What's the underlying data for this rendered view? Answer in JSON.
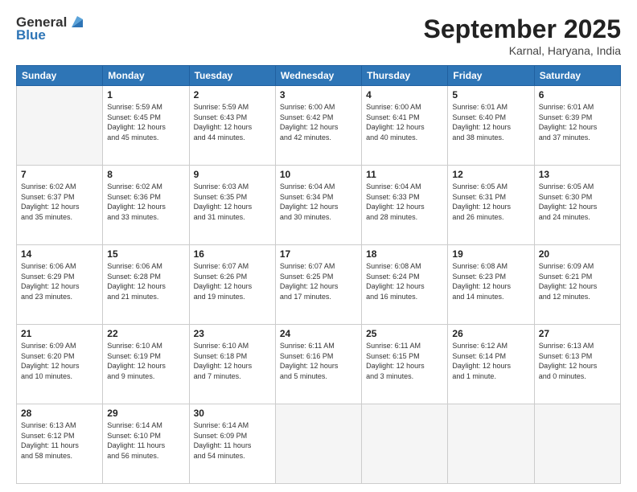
{
  "header": {
    "logo_general": "General",
    "logo_blue": "Blue",
    "title": "September 2025",
    "subtitle": "Karnal, Haryana, India"
  },
  "calendar": {
    "days_of_week": [
      "Sunday",
      "Monday",
      "Tuesday",
      "Wednesday",
      "Thursday",
      "Friday",
      "Saturday"
    ],
    "weeks": [
      [
        {
          "day": "",
          "info": ""
        },
        {
          "day": "1",
          "info": "Sunrise: 5:59 AM\nSunset: 6:45 PM\nDaylight: 12 hours\nand 45 minutes."
        },
        {
          "day": "2",
          "info": "Sunrise: 5:59 AM\nSunset: 6:43 PM\nDaylight: 12 hours\nand 44 minutes."
        },
        {
          "day": "3",
          "info": "Sunrise: 6:00 AM\nSunset: 6:42 PM\nDaylight: 12 hours\nand 42 minutes."
        },
        {
          "day": "4",
          "info": "Sunrise: 6:00 AM\nSunset: 6:41 PM\nDaylight: 12 hours\nand 40 minutes."
        },
        {
          "day": "5",
          "info": "Sunrise: 6:01 AM\nSunset: 6:40 PM\nDaylight: 12 hours\nand 38 minutes."
        },
        {
          "day": "6",
          "info": "Sunrise: 6:01 AM\nSunset: 6:39 PM\nDaylight: 12 hours\nand 37 minutes."
        }
      ],
      [
        {
          "day": "7",
          "info": "Sunrise: 6:02 AM\nSunset: 6:37 PM\nDaylight: 12 hours\nand 35 minutes."
        },
        {
          "day": "8",
          "info": "Sunrise: 6:02 AM\nSunset: 6:36 PM\nDaylight: 12 hours\nand 33 minutes."
        },
        {
          "day": "9",
          "info": "Sunrise: 6:03 AM\nSunset: 6:35 PM\nDaylight: 12 hours\nand 31 minutes."
        },
        {
          "day": "10",
          "info": "Sunrise: 6:04 AM\nSunset: 6:34 PM\nDaylight: 12 hours\nand 30 minutes."
        },
        {
          "day": "11",
          "info": "Sunrise: 6:04 AM\nSunset: 6:33 PM\nDaylight: 12 hours\nand 28 minutes."
        },
        {
          "day": "12",
          "info": "Sunrise: 6:05 AM\nSunset: 6:31 PM\nDaylight: 12 hours\nand 26 minutes."
        },
        {
          "day": "13",
          "info": "Sunrise: 6:05 AM\nSunset: 6:30 PM\nDaylight: 12 hours\nand 24 minutes."
        }
      ],
      [
        {
          "day": "14",
          "info": "Sunrise: 6:06 AM\nSunset: 6:29 PM\nDaylight: 12 hours\nand 23 minutes."
        },
        {
          "day": "15",
          "info": "Sunrise: 6:06 AM\nSunset: 6:28 PM\nDaylight: 12 hours\nand 21 minutes."
        },
        {
          "day": "16",
          "info": "Sunrise: 6:07 AM\nSunset: 6:26 PM\nDaylight: 12 hours\nand 19 minutes."
        },
        {
          "day": "17",
          "info": "Sunrise: 6:07 AM\nSunset: 6:25 PM\nDaylight: 12 hours\nand 17 minutes."
        },
        {
          "day": "18",
          "info": "Sunrise: 6:08 AM\nSunset: 6:24 PM\nDaylight: 12 hours\nand 16 minutes."
        },
        {
          "day": "19",
          "info": "Sunrise: 6:08 AM\nSunset: 6:23 PM\nDaylight: 12 hours\nand 14 minutes."
        },
        {
          "day": "20",
          "info": "Sunrise: 6:09 AM\nSunset: 6:21 PM\nDaylight: 12 hours\nand 12 minutes."
        }
      ],
      [
        {
          "day": "21",
          "info": "Sunrise: 6:09 AM\nSunset: 6:20 PM\nDaylight: 12 hours\nand 10 minutes."
        },
        {
          "day": "22",
          "info": "Sunrise: 6:10 AM\nSunset: 6:19 PM\nDaylight: 12 hours\nand 9 minutes."
        },
        {
          "day": "23",
          "info": "Sunrise: 6:10 AM\nSunset: 6:18 PM\nDaylight: 12 hours\nand 7 minutes."
        },
        {
          "day": "24",
          "info": "Sunrise: 6:11 AM\nSunset: 6:16 PM\nDaylight: 12 hours\nand 5 minutes."
        },
        {
          "day": "25",
          "info": "Sunrise: 6:11 AM\nSunset: 6:15 PM\nDaylight: 12 hours\nand 3 minutes."
        },
        {
          "day": "26",
          "info": "Sunrise: 6:12 AM\nSunset: 6:14 PM\nDaylight: 12 hours\nand 1 minute."
        },
        {
          "day": "27",
          "info": "Sunrise: 6:13 AM\nSunset: 6:13 PM\nDaylight: 12 hours\nand 0 minutes."
        }
      ],
      [
        {
          "day": "28",
          "info": "Sunrise: 6:13 AM\nSunset: 6:12 PM\nDaylight: 11 hours\nand 58 minutes."
        },
        {
          "day": "29",
          "info": "Sunrise: 6:14 AM\nSunset: 6:10 PM\nDaylight: 11 hours\nand 56 minutes."
        },
        {
          "day": "30",
          "info": "Sunrise: 6:14 AM\nSunset: 6:09 PM\nDaylight: 11 hours\nand 54 minutes."
        },
        {
          "day": "",
          "info": ""
        },
        {
          "day": "",
          "info": ""
        },
        {
          "day": "",
          "info": ""
        },
        {
          "day": "",
          "info": ""
        }
      ]
    ]
  }
}
